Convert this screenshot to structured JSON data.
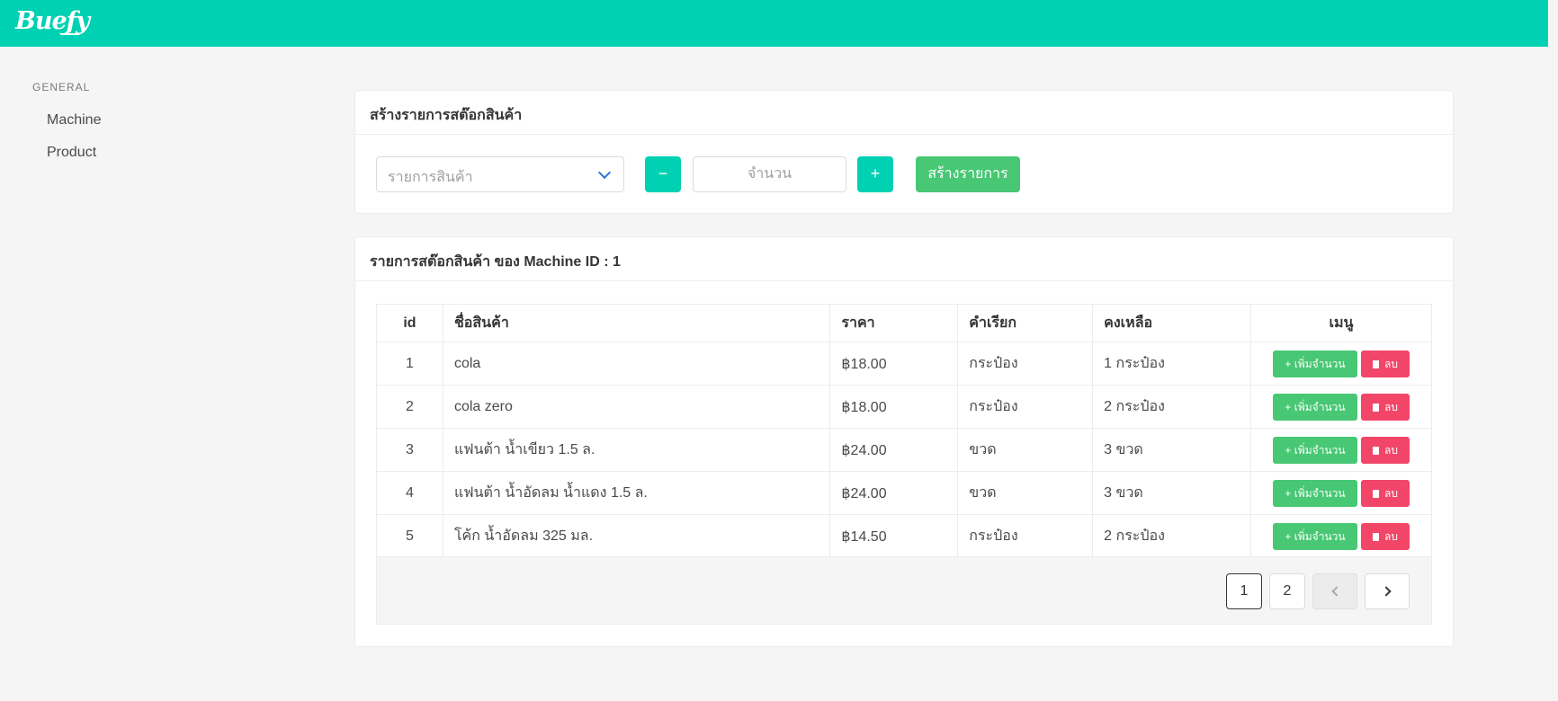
{
  "navbar": {
    "brand": "Buefy"
  },
  "sidebar": {
    "label": "GENERAL",
    "items": [
      {
        "label": "Machine"
      },
      {
        "label": "Product"
      }
    ]
  },
  "create_card": {
    "title": "สร้างรายการสต๊อกสินค้า",
    "product_select_placeholder": "รายการสินค้า",
    "minus_label": "−",
    "quantity_placeholder": "จำนวน",
    "plus_label": "+",
    "create_button": "สร้างรายการ"
  },
  "stock_card": {
    "title": "รายการสต๊อกสินค้า ของ Machine ID : 1",
    "columns": [
      "id",
      "ชื่อสินค้า",
      "ราคา",
      "คำเรียก",
      "คงเหลือ",
      "เมนู"
    ],
    "rows": [
      {
        "id": "1",
        "name": "cola",
        "price": "฿18.00",
        "unit": "กระป๋อง",
        "remaining": "1 กระป๋อง"
      },
      {
        "id": "2",
        "name": "cola zero",
        "price": "฿18.00",
        "unit": "กระป๋อง",
        "remaining": "2 กระป๋อง"
      },
      {
        "id": "3",
        "name": "แฟนต้า น้ำเขียว 1.5 ล.",
        "price": "฿24.00",
        "unit": "ขวด",
        "remaining": "3 ขวด"
      },
      {
        "id": "4",
        "name": "แฟนต้า น้ำอัดลม น้ำแดง 1.5 ล.",
        "price": "฿24.00",
        "unit": "ขวด",
        "remaining": "3 ขวด"
      },
      {
        "id": "5",
        "name": "โค้ก น้ำอัดลม 325 มล.",
        "price": "฿14.50",
        "unit": "กระป๋อง",
        "remaining": "2 กระป๋อง"
      }
    ],
    "row_actions": {
      "add": "+ เพิ่มจำนวน",
      "delete": "ลบ"
    },
    "pagination": {
      "pages": [
        "1",
        "2"
      ],
      "current": "1"
    }
  }
}
